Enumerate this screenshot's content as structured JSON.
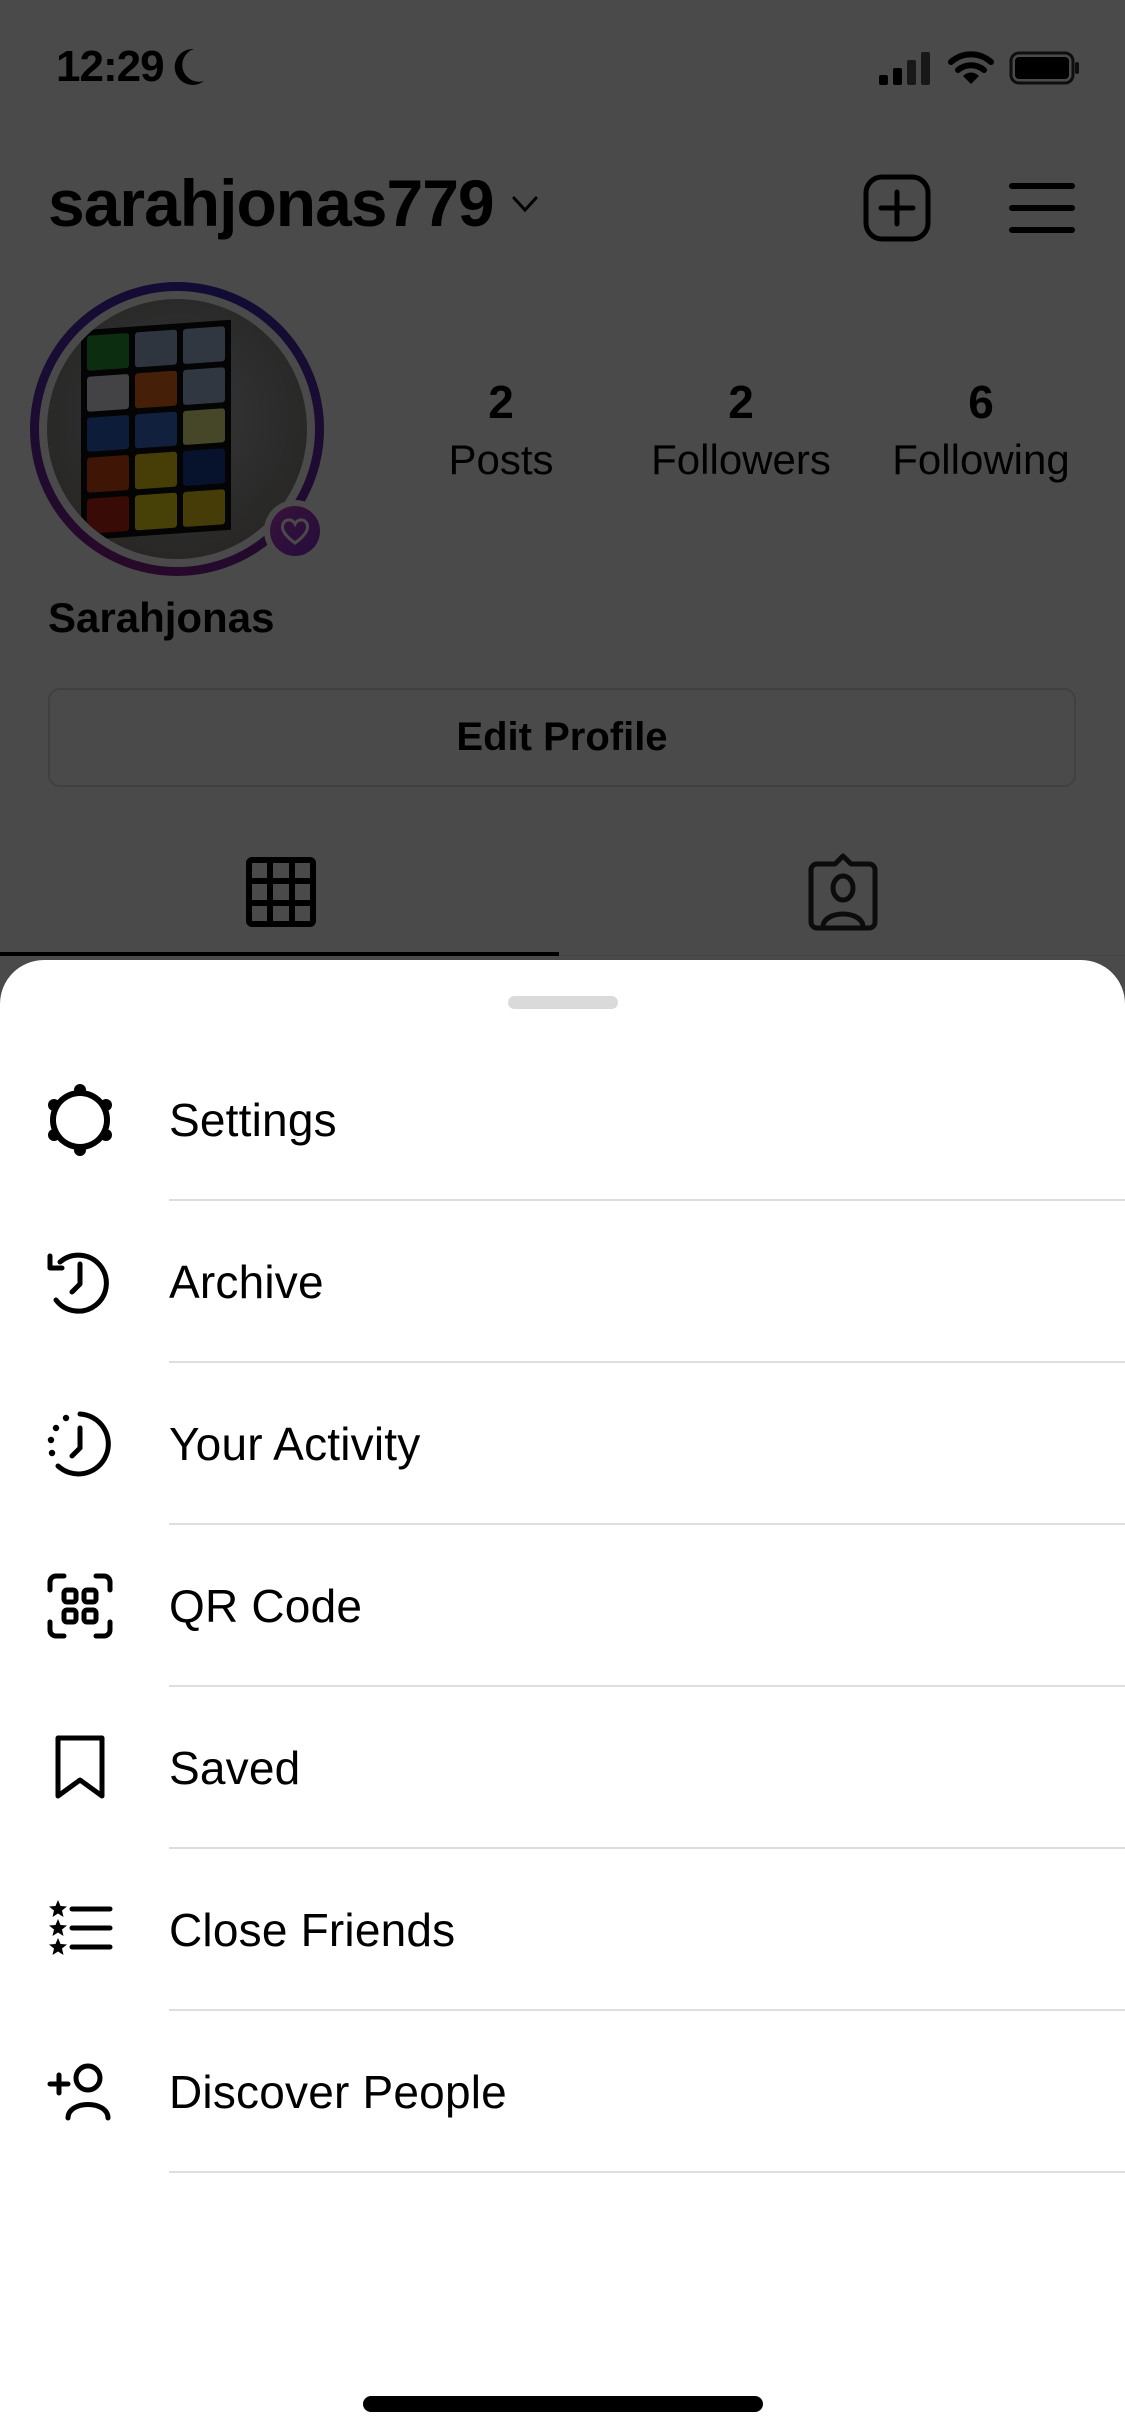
{
  "status_bar": {
    "time": "12:29",
    "focus_icon": "moon-icon",
    "signal_icon": "cellular-signal-icon",
    "wifi_icon": "wifi-icon",
    "battery_icon": "battery-icon"
  },
  "header": {
    "username": "sarahjonas779",
    "account_switcher_icon": "chevron-down-icon",
    "new_post_icon": "plus-square-icon",
    "menu_icon": "hamburger-menu-icon"
  },
  "profile": {
    "display_name": "Sarahjonas",
    "avatar_badge_icon": "heart-badge-icon",
    "stats": [
      {
        "value": "2",
        "label": "Posts"
      },
      {
        "value": "2",
        "label": "Followers"
      },
      {
        "value": "6",
        "label": "Following"
      }
    ],
    "edit_button_label": "Edit Profile",
    "tabs": [
      {
        "icon": "grid-icon",
        "active": true
      },
      {
        "icon": "tagged-person-icon",
        "active": false
      }
    ],
    "ring_colors": [
      "#8a1f8e",
      "#3b2ab3"
    ]
  },
  "sheet": {
    "items": [
      {
        "label": "Settings",
        "icon": "settings-gear-icon"
      },
      {
        "label": "Archive",
        "icon": "archive-clock-icon"
      },
      {
        "label": "Your Activity",
        "icon": "activity-clock-icon"
      },
      {
        "label": "QR Code",
        "icon": "qr-code-icon"
      },
      {
        "label": "Saved",
        "icon": "bookmark-icon"
      },
      {
        "label": "Close Friends",
        "icon": "close-friends-list-icon"
      },
      {
        "label": "Discover People",
        "icon": "add-person-icon"
      }
    ]
  }
}
